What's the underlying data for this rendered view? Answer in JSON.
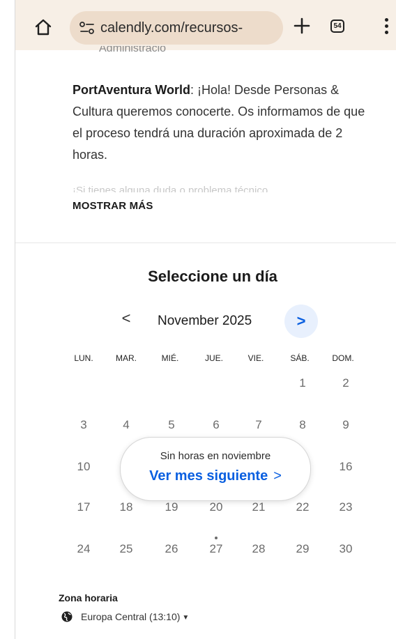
{
  "browser": {
    "url": "calendly.com/recursos-",
    "tab_count": "54"
  },
  "description": {
    "cut_line": "Administració",
    "company": "PortAventura World",
    "text": ": ¡Hola! Desde Personas & Cultura queremos conocerte. Os informamos de que el proceso tendrá una duración aproximada de 2 horas.",
    "faded": "¡Si tienes alguna duda o problema técnico",
    "show_more": "MOSTRAR MÁS"
  },
  "calendar": {
    "title": "Seleccione un día",
    "month": "November 2025",
    "prev": "<",
    "next": ">",
    "weekdays": [
      "LUN.",
      "MAR.",
      "MIÉ.",
      "JUE.",
      "VIE.",
      "SÁB.",
      "DOM."
    ],
    "rows": [
      [
        "",
        "",
        "",
        "",
        "",
        "1",
        "2"
      ],
      [
        "3",
        "4",
        "5",
        "6",
        "7",
        "8",
        "9"
      ],
      [
        "10",
        "",
        "",
        "",
        "",
        "",
        "16"
      ],
      [
        "17",
        "18",
        "19",
        "20",
        "21",
        "22",
        "23"
      ],
      [
        "24",
        "25",
        "26",
        "27",
        "28",
        "29",
        "30"
      ]
    ],
    "popup": {
      "message": "Sin horas en noviembre",
      "link": "Ver mes siguiente",
      "chevron": ">"
    }
  },
  "timezone": {
    "label": "Zona horaria",
    "value": "Europa Central (13:10)"
  }
}
